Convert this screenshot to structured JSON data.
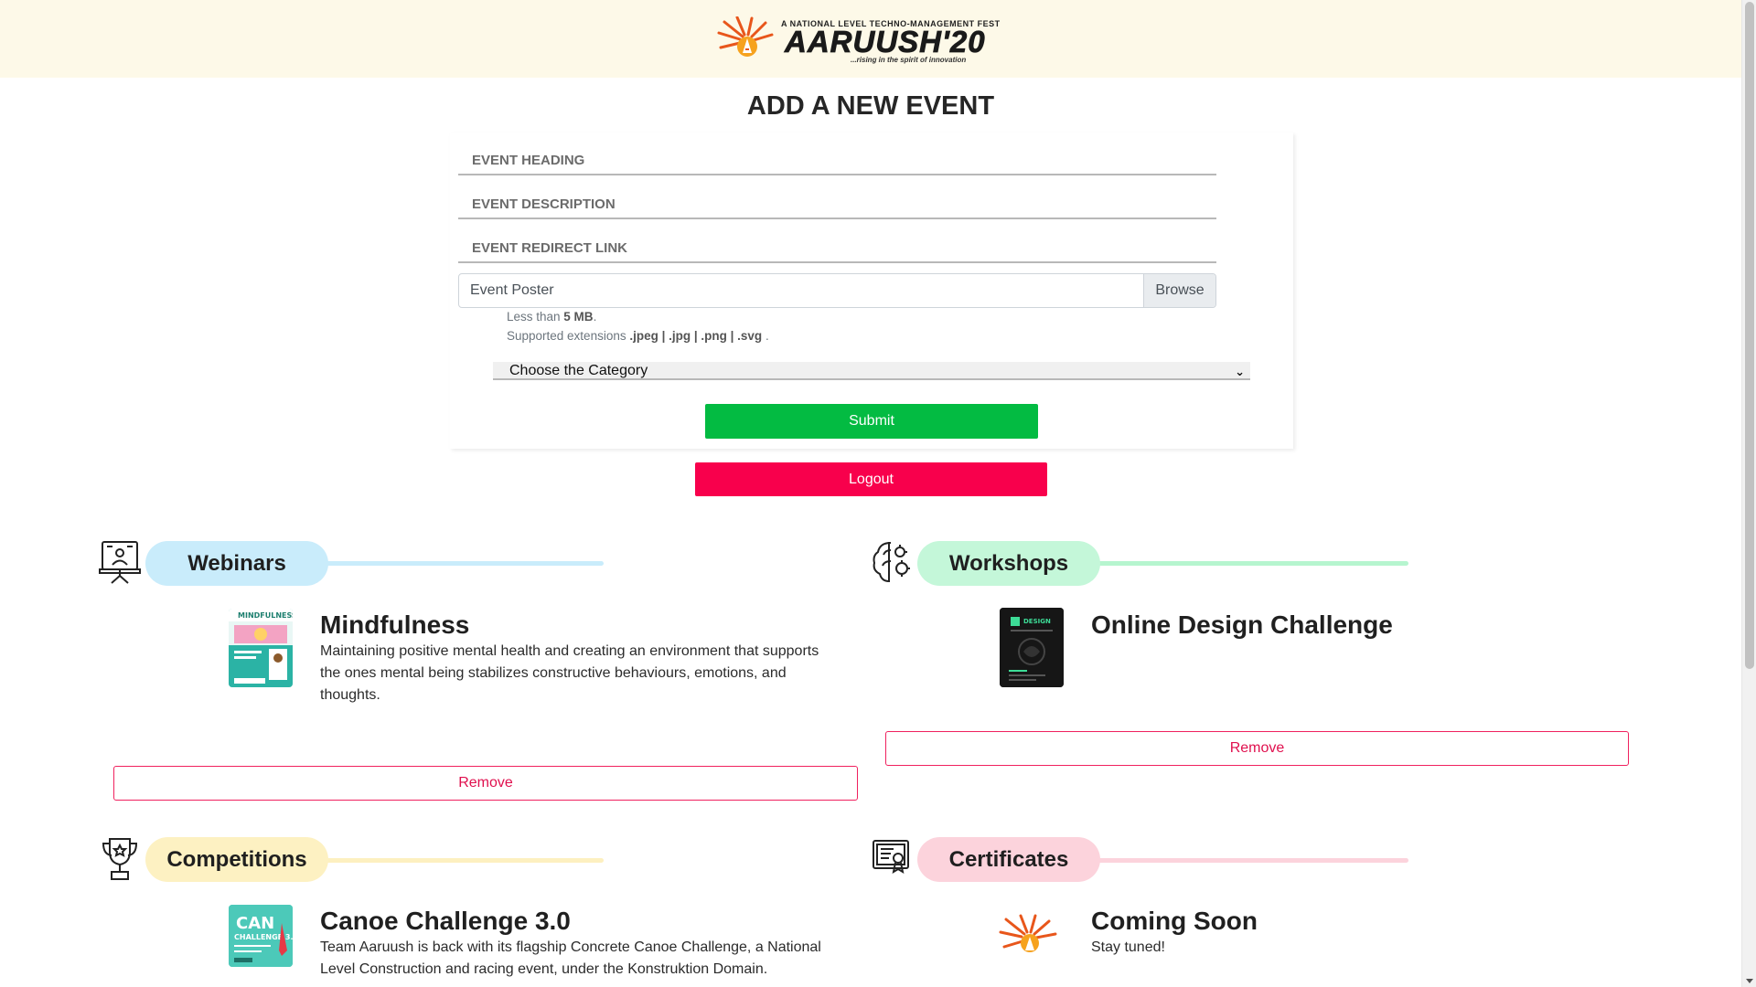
{
  "header": {
    "logo_tagline": "A NATIONAL LEVEL TECHNO-MANAGEMENT FEST",
    "logo_word": "AARUUSH'20",
    "logo_sub": "...rising in the spirit of innovation"
  },
  "page_title": "ADD A NEW EVENT",
  "form": {
    "heading_placeholder": "EVENT HEADING",
    "description_placeholder": "EVENT DESCRIPTION",
    "link_placeholder": "EVENT REDIRECT LINK",
    "poster_label": "Event Poster",
    "browse_label": "Browse",
    "size_hint_prefix": "Less than ",
    "size_hint_value": "5 MB",
    "size_hint_suffix": ".",
    "ext_hint_prefix": "Supported extensions ",
    "ext_hint_value": ".jpeg | .jpg | .png | .svg",
    "ext_hint_suffix": " .",
    "category_selected": "Choose the Category",
    "submit_label": "Submit"
  },
  "logout_label": "Logout",
  "sections": {
    "webinars": {
      "title": "Webinars",
      "icon": "presentation-icon",
      "pill_color": "#c9ecfb",
      "line_color": "#c9ecfb",
      "event_title": "Mindfulness",
      "event_desc": "Maintaining positive mental health and creating an environment that supports the ones mental being stabilizes constructive behaviours, emotions, and thoughts.",
      "remove_label": "Remove"
    },
    "workshops": {
      "title": "Workshops",
      "icon": "brain-gear-icon",
      "pill_color": "#c4f7d9",
      "line_color": "#b6f5cf",
      "event_title": "Online Design Challenge",
      "remove_label": "Remove"
    },
    "competitions": {
      "title": "Competitions",
      "icon": "trophy-icon",
      "pill_color": "#fdf1c2",
      "line_color": "#fdf0c0",
      "event_title": "Canoe Challenge 3.0",
      "event_desc": "Team Aaruush is back with its flagship Concrete Canoe Challenge, a National Level Construction and racing event, under the Konstruktion Domain."
    },
    "certificates": {
      "title": "Certificates",
      "icon": "certificate-icon",
      "pill_color": "#fcd3dc",
      "line_color": "#fcd3dc",
      "event_title": "Coming Soon",
      "event_desc": "Stay tuned!"
    }
  },
  "colors": {
    "header_bg": "#fdf9e8",
    "submit": "#03bb42",
    "logout": "#f8004c",
    "remove_border": "#f0215e"
  }
}
